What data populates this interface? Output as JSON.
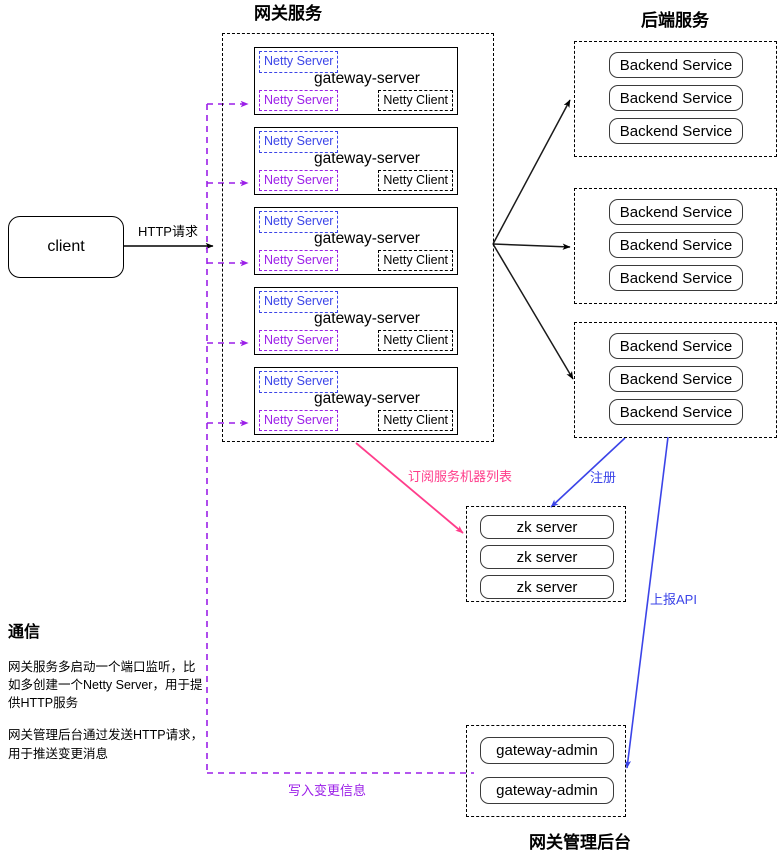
{
  "titles": {
    "gateway_services": "网关服务",
    "backend_services": "后端服务",
    "gateway_admin": "网关管理后台"
  },
  "client": {
    "label": "client"
  },
  "edges": {
    "http_request": "HTTP请求",
    "subscribe_service_list": "订阅服务机器列表",
    "register": "注册",
    "report_api": "上报API",
    "write_change_info": "写入变更信息"
  },
  "gateway_servers": [
    {
      "title": "gateway-server",
      "netty_server_top": "Netty Server",
      "netty_server_bottom": "Netty Server",
      "netty_client": "Netty Client"
    },
    {
      "title": "gateway-server",
      "netty_server_top": "Netty Server",
      "netty_server_bottom": "Netty Server",
      "netty_client": "Netty Client"
    },
    {
      "title": "gateway-server",
      "netty_server_top": "Netty Server",
      "netty_server_bottom": "Netty Server",
      "netty_client": "Netty Client"
    },
    {
      "title": "gateway-server",
      "netty_server_top": "Netty Server",
      "netty_server_bottom": "Netty Server",
      "netty_client": "Netty Client"
    },
    {
      "title": "gateway-server",
      "netty_server_top": "Netty Server",
      "netty_server_bottom": "Netty Server",
      "netty_client": "Netty Client"
    }
  ],
  "backend_groups": [
    {
      "services": [
        "Backend Service",
        "Backend Service",
        "Backend Service"
      ]
    },
    {
      "services": [
        "Backend Service",
        "Backend Service",
        "Backend Service"
      ]
    },
    {
      "services": [
        "Backend Service",
        "Backend Service",
        "Backend Service"
      ]
    }
  ],
  "zk_cluster": {
    "nodes": [
      "zk server",
      "zk server",
      "zk server"
    ]
  },
  "admin_cluster": {
    "nodes": [
      "gateway-admin",
      "gateway-admin"
    ]
  },
  "notes": {
    "heading": "通信",
    "paragraph1": "网关服务多启动一个端口监听，比如多创建一个Netty Server，用于提供HTTP服务",
    "paragraph2": "网关管理后台通过发送HTTP请求，用于推送变更消息"
  },
  "colors": {
    "blue": "#3b44e8",
    "purple": "#9b1fe8",
    "pink": "#ff3d8b",
    "black": "#000000"
  }
}
